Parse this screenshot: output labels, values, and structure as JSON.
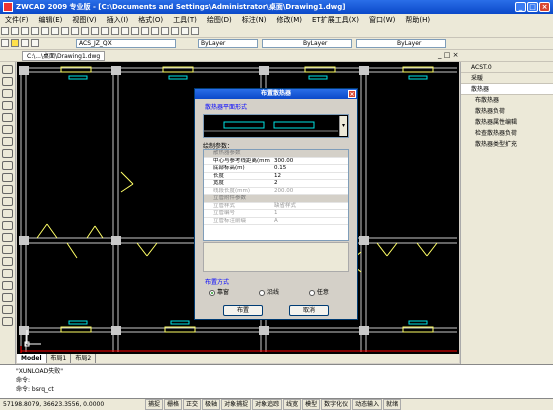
{
  "window": {
    "title": "ZWCAD 2009 专业版 - [C:\\Documents and Settings\\Administrator\\桌面\\Drawing1.dwg]"
  },
  "menu": [
    "文件(F)",
    "编辑(E)",
    "视图(V)",
    "插入(I)",
    "格式(O)",
    "工具(T)",
    "绘图(D)",
    "标注(N)",
    "修改(M)",
    "ET扩展工具(X)",
    "窗口(W)",
    "帮助(H)"
  ],
  "toolbar": {
    "layer_combo": "ACS_JZ_QX",
    "color_combo": "ByLayer",
    "linetype_combo": "ByLayer",
    "lineweight_combo": "ByLayer"
  },
  "drawing_tab": "C:\\...\\桌面\\Drawing1.dwg",
  "right_panel": {
    "items": [
      {
        "label": "ACST.0",
        "type": "head"
      },
      {
        "label": "采暖",
        "type": "head"
      },
      {
        "label": "散热器",
        "type": "head"
      },
      {
        "label": "布散热器",
        "type": "item"
      },
      {
        "label": "散热器负荷",
        "type": "item"
      },
      {
        "label": "散热器属性编辑",
        "type": "item"
      },
      {
        "label": "检查散热器负荷",
        "type": "item"
      },
      {
        "label": "散热器类型扩充",
        "type": "item"
      }
    ]
  },
  "dialog": {
    "title": "布置散热器",
    "section_plan": "散热器平面形式",
    "section_params": "绘制参数：",
    "properties": [
      {
        "label": "散热器参数",
        "value": "",
        "kind": "cat"
      },
      {
        "label": "中心与参考线距离(mm)",
        "value": "300.00",
        "kind": "row"
      },
      {
        "label": "底部标高(m)",
        "value": "0.15",
        "kind": "row"
      },
      {
        "label": "长度",
        "value": "12",
        "kind": "row"
      },
      {
        "label": "宽度",
        "value": "2",
        "kind": "row"
      },
      {
        "label": "线段长度(mm)",
        "value": "200.00",
        "kind": "dis"
      },
      {
        "label": "立管附件参数",
        "value": "",
        "kind": "cat"
      },
      {
        "label": "立管样式",
        "value": "缺省样式",
        "kind": "dis"
      },
      {
        "label": "立管编号",
        "value": "1",
        "kind": "dis"
      },
      {
        "label": "立管标注前缀",
        "value": "A",
        "kind": "dis"
      }
    ],
    "section_layout": "布置方式",
    "options": [
      "靠窗",
      "沿线",
      "任意"
    ],
    "selected_option": "靠窗",
    "btn_place": "布置",
    "btn_cancel": "取消"
  },
  "layout_tabs": [
    "Model",
    "布局1",
    "布局2"
  ],
  "command": {
    "line1": "\"XUNLOAD失败\"",
    "line2": "命令:",
    "line3": "命令: bsrq_ct"
  },
  "status": {
    "coords": "57198.8079, 36623.3556, 0.0000",
    "buttons": [
      "捕捉",
      "栅格",
      "正交",
      "极轴",
      "对象捕捉",
      "对象追踪",
      "线宽",
      "模型",
      "数字化仪",
      "动态输入",
      "就绪"
    ]
  },
  "colors": {
    "title_blue": "#0b49c9",
    "wall": "#c9c9c9",
    "window_cyan": "#00e5e5",
    "door_yellow": "#ffff66",
    "dim_red": "#ff0000"
  }
}
